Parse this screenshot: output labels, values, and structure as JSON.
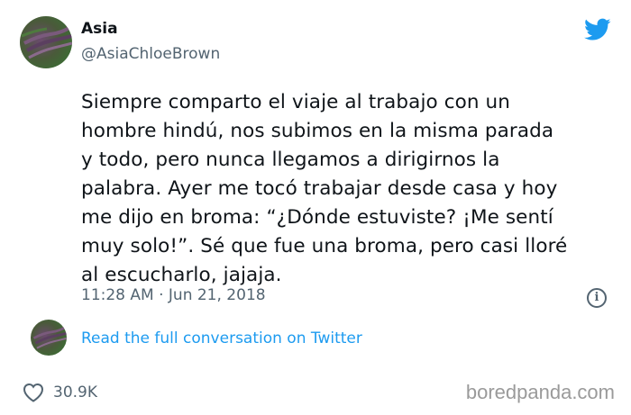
{
  "tweet": {
    "author_name": "Asia",
    "author_handle": "@AsiaChloeBrown",
    "text": "Siempre comparto el viaje al trabajo con un\nhombre hindú, nos subimos en la misma parada\ny todo, pero nunca llegamos a dirigirnos la\npalabra. Ayer me tocó trabajar desde casa y hoy\nme dijo en broma: “¿Dónde estuviste? ¡Me sentí\nmuy solo!”. Sé que fue una broma, pero casi lloré\nal escucharlo, jajaja.",
    "timestamp": "11:28 AM · Jun 21, 2018",
    "info_glyph": "i",
    "read_full_label": "Read the full conversation on Twitter",
    "like_count": "30.9K"
  },
  "icons": {
    "brand": "twitter-bird-icon",
    "info": "info-icon",
    "like": "heart-icon"
  },
  "colors": {
    "accent": "#1d9bf0",
    "secondary_text": "#536471",
    "watermark": "#9a9a9a"
  },
  "watermark": "boredpanda.com"
}
